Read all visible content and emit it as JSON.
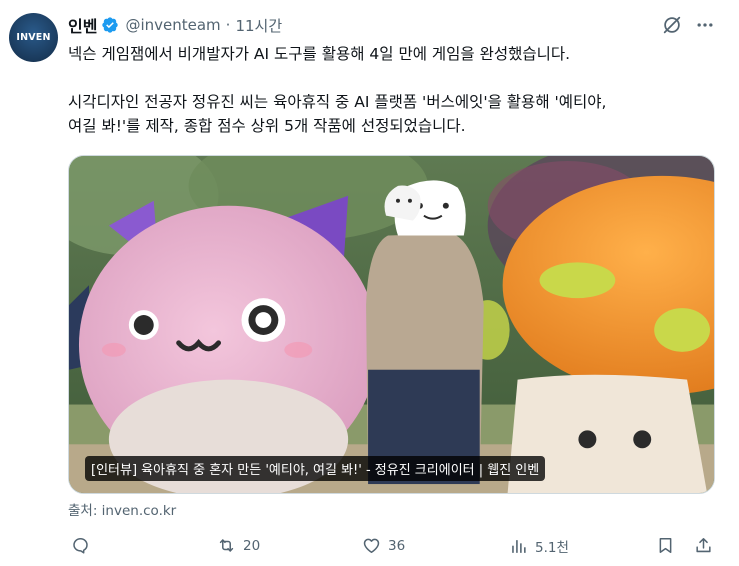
{
  "author": {
    "avatar_text": "INVEN",
    "display_name": "인벤",
    "handle": "@inventeam",
    "separator": "·",
    "time": "11시간"
  },
  "tweet": {
    "line1": "넥슨 게임잼에서 비개발자가 AI 도구를 활용해 4일 만에 게임을 완성했습니다.",
    "line2": "시각디자인 전공자 정유진 씨는 육아휴직 중 AI 플랫폼 '버스에잇'을 활용해 '예티야,",
    "line3": "여길 봐!'를 제작, 종합 점수 상위 5개 작품에 선정되었습니다."
  },
  "card": {
    "caption": "[인터뷰] 육아휴직 중 혼자 만든 '예티야, 여길 봐!' - 정유진 크리에이터 | 웹진 인벤"
  },
  "source": "출처: inven.co.kr",
  "actions": {
    "reply_count": "",
    "retweet_count": "20",
    "like_count": "36",
    "views_count": "5.1천"
  },
  "colors": {
    "verified": "#1d9bf0",
    "secondary_text": "#536471",
    "primary_text": "#0f1419"
  }
}
